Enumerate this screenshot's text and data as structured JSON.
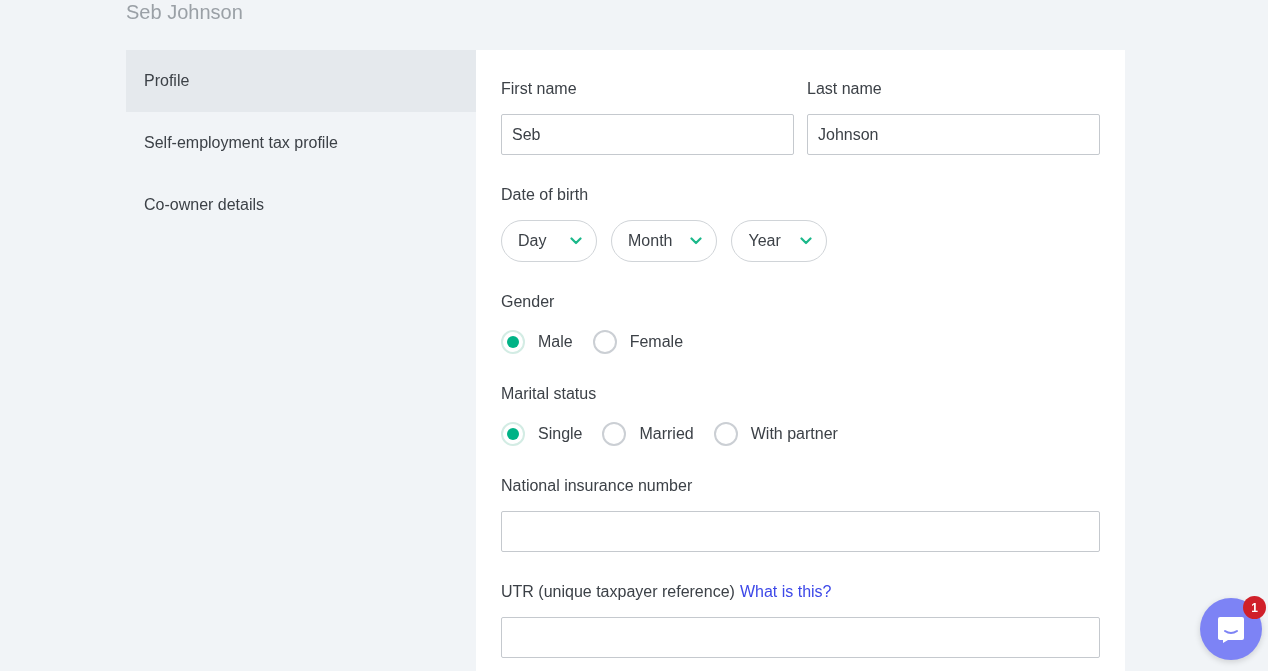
{
  "page_title": "Seb Johnson",
  "sidebar": {
    "items": [
      {
        "label": "Profile",
        "selected": true
      },
      {
        "label": "Self-employment tax profile",
        "selected": false
      },
      {
        "label": "Co-owner details",
        "selected": false
      }
    ]
  },
  "form": {
    "name_fields": [
      {
        "label": "First name",
        "value": "Seb"
      },
      {
        "label": "Last name",
        "value": "Johnson"
      }
    ],
    "date_of_birth": {
      "label": "Date of birth",
      "selects": [
        {
          "value": "Day"
        },
        {
          "value": "Month"
        },
        {
          "value": "Year"
        }
      ]
    },
    "radio_groups": [
      {
        "label": "Gender",
        "options": [
          {
            "label": "Male",
            "selected": true
          },
          {
            "label": "Female",
            "selected": false
          }
        ]
      },
      {
        "label": "Marital status",
        "options": [
          {
            "label": "Single",
            "selected": true
          },
          {
            "label": "Married",
            "selected": false
          },
          {
            "label": "With partner",
            "selected": false
          }
        ]
      }
    ],
    "national_insurance": {
      "label": "National insurance number"
    },
    "utr": {
      "label": "UTR (unique taxpayer reference)",
      "link": "What is this?"
    }
  },
  "chat_button": {
    "badge": "1"
  }
}
